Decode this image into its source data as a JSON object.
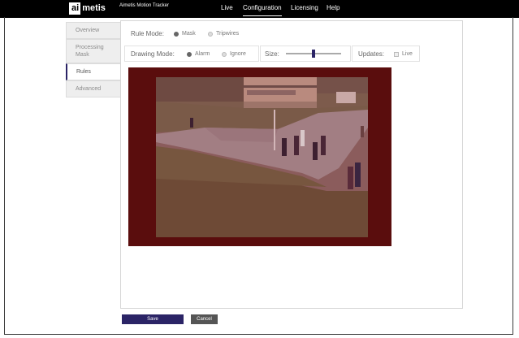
{
  "header": {
    "logo_box": "ai",
    "logo_rest": "metis",
    "app_title": "Aimetis Motion Tracker",
    "nav": [
      "Live",
      "Configuration",
      "Licensing",
      "Help"
    ],
    "active_nav": "Configuration"
  },
  "tabs": [
    {
      "label": "Overview",
      "active": false
    },
    {
      "label": "Processing Mask",
      "active": false
    },
    {
      "label": "Rules",
      "active": true
    },
    {
      "label": "Advanced",
      "active": false
    }
  ],
  "rule_mode": {
    "label": "Rule Mode:",
    "options": [
      "Mask",
      "Tripwires"
    ],
    "selected": "Mask"
  },
  "drawing_mode": {
    "label": "Drawing Mode:",
    "options": [
      "Alarm",
      "Ignore"
    ],
    "selected": "Alarm"
  },
  "size": {
    "label": "Size:",
    "value_fraction": 0.5
  },
  "updates": {
    "label": "Updates:",
    "option": "Live",
    "checked": false
  },
  "buttons": {
    "save": "Save",
    "cancel": "Cancel"
  },
  "colors": {
    "accent": "#2b2466",
    "mask_overlay": "#5a0d0d",
    "topbar": "#000000"
  }
}
